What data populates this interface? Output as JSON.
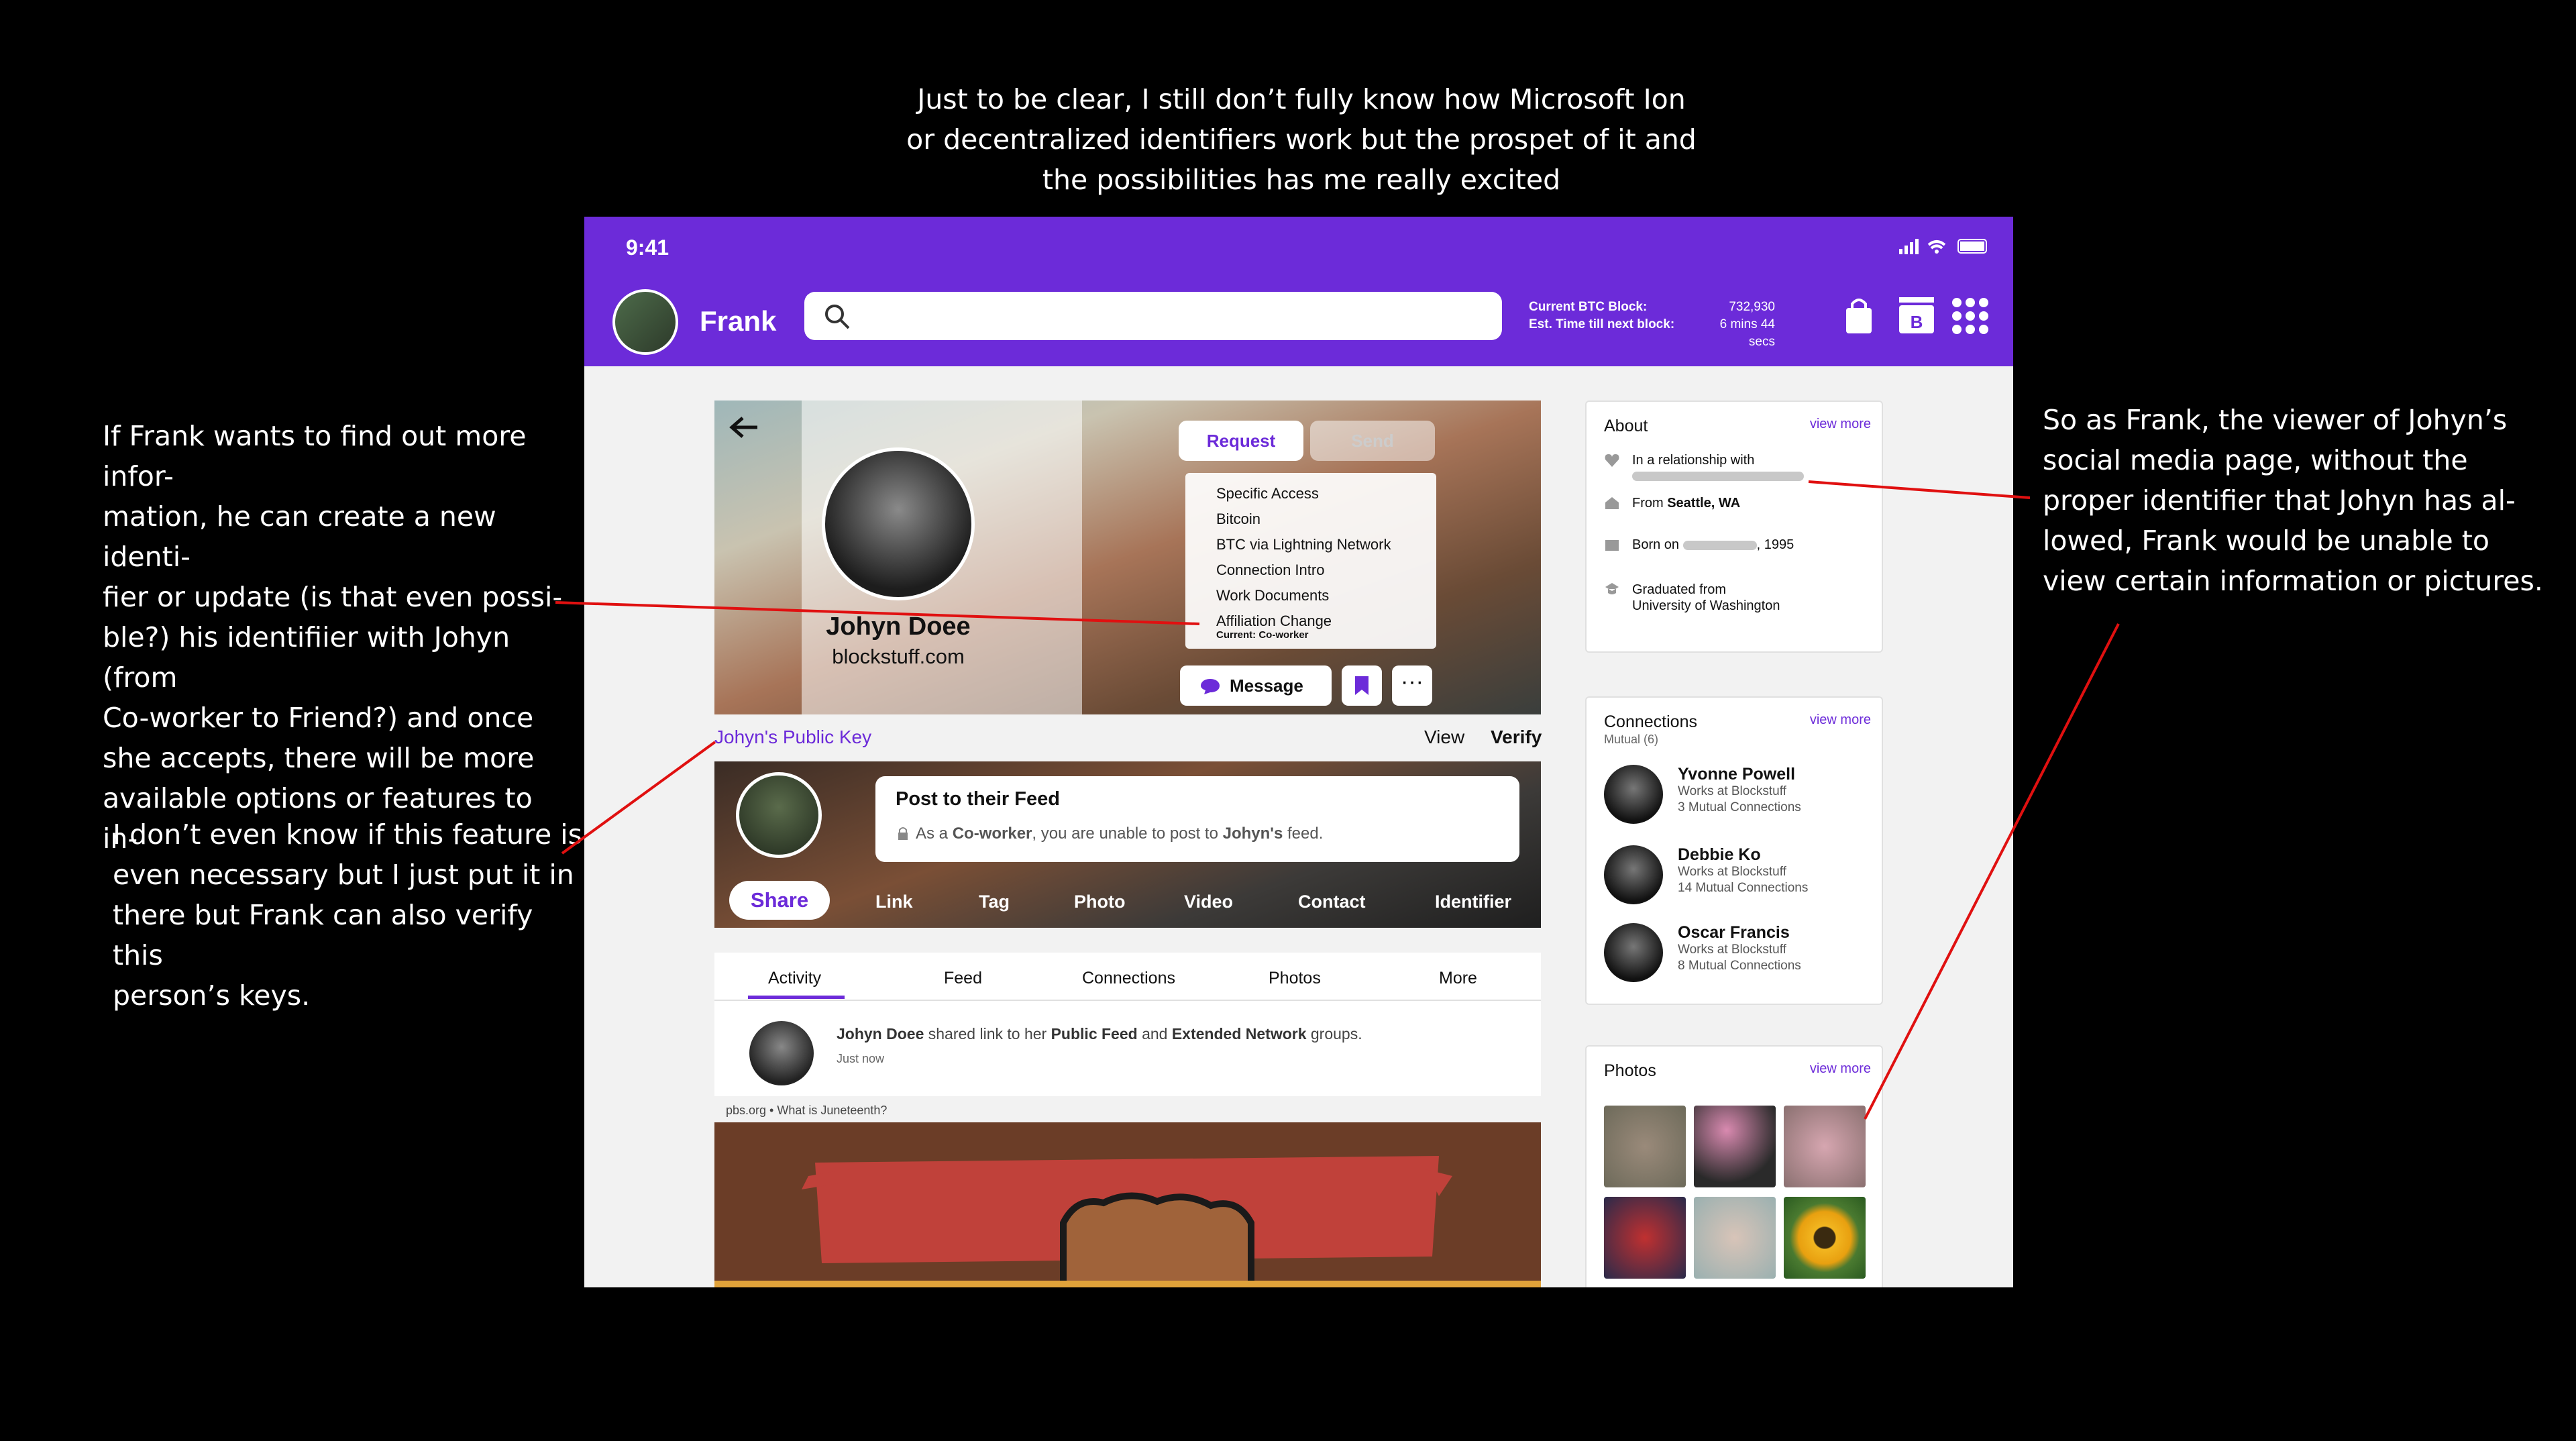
{
  "notes": {
    "top": "Just to be clear, I still don’t fully know how Microsoft Ion or decentralized identifiers work but the prospet of it and the possibilities has me really excited",
    "left1": "If Frank wants to find out more infor-\nmation, he can create a new identi-\nfier or  update (is that even possi-\nble?) his identifiier with Johyn (from\nCo-worker to Friend?) and once\nshe accepts, there will be more\navailable options or features to in-",
    "left2": "I don’t even know if this feature is\neven necessary but I just put it in\nthere but Frank can also verify this\nperson’s keys.",
    "right": "So as Frank, the viewer of Johyn’s\nsocial media page, without the\nproper identifier that Johyn has al-\nlowed, Frank would be unable to\nview certain information or pictures."
  },
  "colors": {
    "brand": "#6c2bd9",
    "annotation_line": "#e01010"
  },
  "status": {
    "time": "9:41"
  },
  "header": {
    "user_name": "Frank",
    "btc_block_label": "Current BTC Block:",
    "btc_block_value": "732,930",
    "btc_time_label": "Est. Time till next block:",
    "btc_time_value": "6 mins 44 secs",
    "icons": [
      "search-icon",
      "shopping-bag-icon",
      "bitcoin-wallet-icon",
      "apps-grid-icon"
    ]
  },
  "profile": {
    "name": "Johyn Doee",
    "site": "blockstuff.com",
    "request_label": "Request",
    "send_label": "Send",
    "request_options": [
      "Specific Access",
      "Bitcoin",
      "BTC via Lightning Network",
      "Connection Intro",
      "Work Documents",
      "Affiliation Change"
    ],
    "affiliation_current": "Current: Co-worker",
    "message_label": "Message",
    "more_label": "···"
  },
  "keys": {
    "public_key_label": "Johyn's Public Key",
    "view_label": "View",
    "verify_label": "Verify"
  },
  "post": {
    "title": "Post to their Feed",
    "note_prefix": "As a ",
    "note_role": "Co-worker",
    "note_mid": ", you are unable to post to ",
    "note_target": "Johyn's",
    "note_suffix": " feed.",
    "share_label": "Share",
    "share_items": [
      "Link",
      "Tag",
      "Photo",
      "Video",
      "Contact",
      "Identifier"
    ]
  },
  "tabs": [
    "Activity",
    "Feed",
    "Connections",
    "Photos",
    "More"
  ],
  "activity": {
    "actor": "Johyn Doee",
    "text1": " shared link to her ",
    "target1": "Public Feed",
    "text2": " and ",
    "target2": "Extended Network",
    "text3": " groups.",
    "time": "Just now",
    "source": "pbs.org  •  What is Juneteenth?"
  },
  "about": {
    "title": "About",
    "view_more": "view more",
    "relationship": "In a relationship with",
    "from_prefix": "From ",
    "from_value": "Seattle, WA",
    "born_prefix": "Born on",
    "born_suffix": ", 1995",
    "grad_line1": "Graduated from",
    "grad_line2": "University of Washington"
  },
  "connections": {
    "title": "Connections",
    "subtitle": "Mutual (6)",
    "view_more": "view more",
    "people": [
      {
        "name": "Yvonne Powell",
        "work": "Works at Blockstuff",
        "mutual": "3 Mutual Connections"
      },
      {
        "name": "Debbie Ko",
        "work": "Works at Blockstuff",
        "mutual": "14 Mutual Connections"
      },
      {
        "name": "Oscar Francis",
        "work": "Works at Blockstuff",
        "mutual": "8 Mutual Connections"
      }
    ]
  },
  "photos": {
    "title": "Photos",
    "view_more": "view more"
  }
}
